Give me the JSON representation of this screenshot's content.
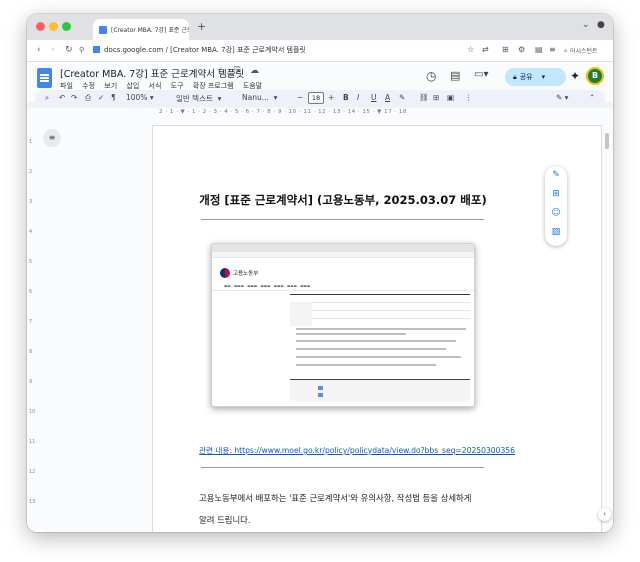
{
  "browser": {
    "tab_title": "[Creator MBA. 7강] 표준 근로...",
    "new_tab": "+",
    "url": "docs.google.com / [Creator MBA. 7강] 표준 근로계약서 템플릿",
    "profile_label": "어시스턴트",
    "nav": {
      "back": "‹",
      "forward": "›",
      "reload": "↻"
    }
  },
  "doc": {
    "title": "[Creator MBA. 7강] 표준 근로계약서 템플릿",
    "title_icons": "☆ ⎘ ☁",
    "menus": [
      "파일",
      "수정",
      "보기",
      "삽입",
      "서식",
      "도구",
      "확장 프로그램",
      "도움말"
    ],
    "share_label": "공유",
    "avatar_letter": "B"
  },
  "toolbar": {
    "zoom": "100%",
    "style": "일반 텍스트",
    "font": "Nanu...",
    "font_size": "18",
    "bold": "B",
    "italic": "I",
    "underline": "U",
    "text_color": "A"
  },
  "ruler": "2 · 1 · ▼ · 1 · 2 · 3 · 4 · 5 · 6 · 7 · 8 · 9 · 10 · 11 · 12 · 13 · 14 · 15 · ▼ 17 · 18",
  "page": {
    "heading": "개정 [표준 근로계약서] (고용노동부, 2025.03.07 배포)",
    "embedded_logo_text": "고용노동부",
    "link_text": "관련 내용: https://www.moel.go.kr/policy/policydata/view.do?bbs_seq=20250300356",
    "paragraph_line1": "고용노동부에서 배포하는 '표준 근로계약서'와 유의사항, 작성법 등을 상세하게",
    "paragraph_line2": "알려 드립니다."
  },
  "colors": {
    "accent": "#1a73e8",
    "share_bg": "#c2e7ff",
    "link": "#1155cc",
    "avatar": "#188038"
  }
}
